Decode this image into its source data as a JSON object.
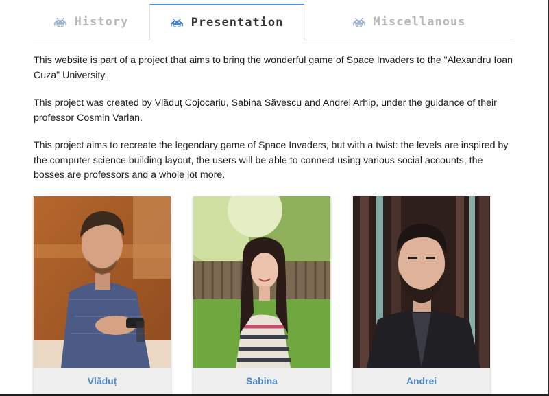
{
  "tabs": [
    {
      "label": "History",
      "icon": "space-invader-icon",
      "active": false
    },
    {
      "label": "Presentation",
      "icon": "space-invader-icon",
      "active": true
    },
    {
      "label": "Miscellanous",
      "icon": "space-invader-icon",
      "active": false
    }
  ],
  "content": {
    "paragraphs": [
      "This website is part of a project that aims to bring the wonderful game of Space Invaders to the \"Alexandru Ioan Cuza\" University.",
      "This project was created by Vlăduț Cojocariu, Sabina Săvescu and Andrei Arhip, under the guidance of their professor Cosmin Varlan.",
      "This project aims to recreate the legendary game of Space Invaders, but with a twist: the levels are inspired by the computer science building layout, the users will be able to connect using various social accounts, the bosses are professors and a whole lot more."
    ]
  },
  "team": [
    {
      "name": "Vlăduț"
    },
    {
      "name": "Sabina"
    },
    {
      "name": "Andrei"
    }
  ],
  "colors": {
    "accent": "#4a90d9",
    "link": "#4a86c6",
    "tab_inactive": "#b9b9b9",
    "tab_active_text": "#333333"
  }
}
